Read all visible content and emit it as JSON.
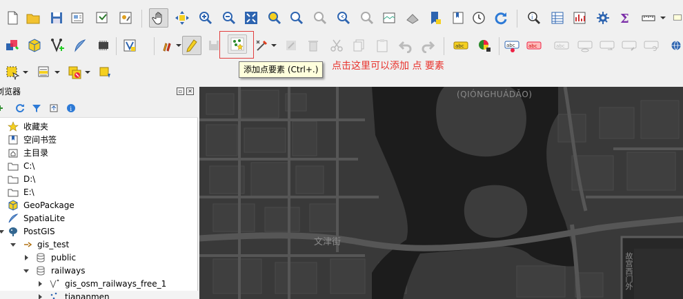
{
  "toolbar": {
    "highlighted_tool": "add-point-feature",
    "tooltip_text": "添加点要素 (Ctrl+.)"
  },
  "annotation": {
    "text": "点击这里可以添加  点  要素",
    "color": "#e8322c"
  },
  "browser": {
    "title": "浏览器",
    "items": [
      {
        "label": "收藏夹",
        "icon": "star-icon",
        "depth": 0
      },
      {
        "label": "空间书签",
        "icon": "bookmark-icon",
        "depth": 0
      },
      {
        "label": "主目录",
        "icon": "home-folder-icon",
        "depth": 0
      },
      {
        "label": "C:\\",
        "icon": "folder-icon",
        "depth": 0
      },
      {
        "label": "D:\\",
        "icon": "folder-icon",
        "depth": 0
      },
      {
        "label": "E:\\",
        "icon": "folder-icon",
        "depth": 0
      },
      {
        "label": "GeoPackage",
        "icon": "geopackage-icon",
        "depth": 0
      },
      {
        "label": "SpatiaLite",
        "icon": "spatialite-feather-icon",
        "depth": 0
      },
      {
        "label": "PostGIS",
        "icon": "postgis-elephant-icon",
        "depth": 0
      },
      {
        "label": "gis_test",
        "icon": "connection-icon",
        "depth": 1
      },
      {
        "label": "public",
        "icon": "schema-db-icon",
        "depth": 2
      },
      {
        "label": "railways",
        "icon": "schema-db-icon",
        "depth": 2
      },
      {
        "label": "gis_osm_railways_free_1",
        "icon": "line-layer-icon",
        "depth": 3
      },
      {
        "label": "tiananmen",
        "icon": "point-layer-icon",
        "depth": 3
      }
    ]
  },
  "map": {
    "labels": {
      "island": "(QIÓNGHUÁDǍO)",
      "street": "文津街",
      "vertical": "故宫西门外"
    },
    "colors": {
      "background": "#393939",
      "water": "#1c1c1c",
      "roads": "#5a5a5a"
    }
  },
  "colors": {
    "highlight_border": "#e23c3c",
    "tooltip_bg": "#ffffdc"
  }
}
